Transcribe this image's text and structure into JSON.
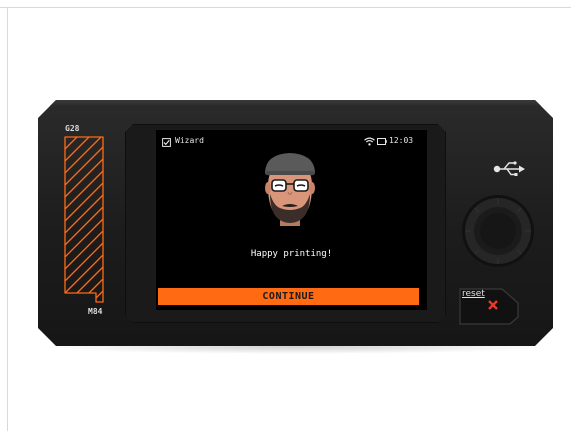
{
  "screen": {
    "header": {
      "title": "Wizard",
      "time": "12:03",
      "icons": [
        "checkbox-icon",
        "wifi-icon",
        "battery-icon"
      ]
    },
    "message": "Happy printing!",
    "continue_label": "CONTINUE"
  },
  "printer": {
    "gcode_top": "G28",
    "gcode_bottom": "M84",
    "reset_label": "reset"
  },
  "colors": {
    "accent": "#ff6a13",
    "screen_bg": "#000000",
    "body": "#222222",
    "reset_mark": "#e8392a"
  }
}
